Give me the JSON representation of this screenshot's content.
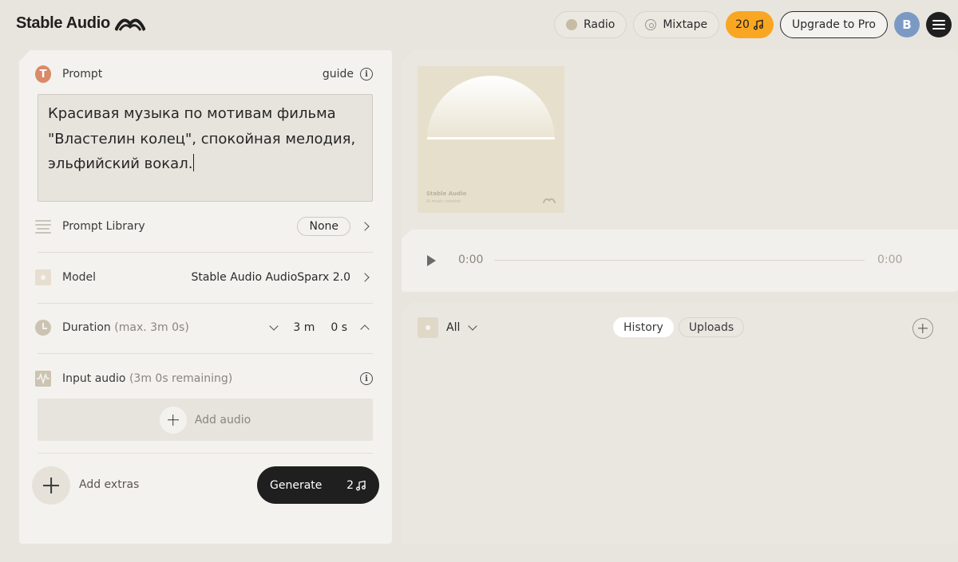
{
  "header": {
    "brand": "Stable Audio",
    "nav": {
      "radio_label": "Radio",
      "mixtape_label": "Mixtape",
      "credits": "20",
      "upgrade_label": "Upgrade to Pro",
      "avatar_initial": "B"
    }
  },
  "form": {
    "prompt": {
      "label": "Prompt",
      "icon_letter": "T",
      "guide_label": "guide",
      "value": "Красивая музыка по мотивам фильма \"Властелин колец\", спокойная мелодия, эльфийский вокал."
    },
    "prompt_library": {
      "label": "Prompt Library",
      "value": "None"
    },
    "model": {
      "label": "Model",
      "value": "Stable Audio AudioSparx 2.0"
    },
    "duration": {
      "label": "Duration",
      "hint": "(max. 3m 0s)",
      "minutes": "3 m",
      "seconds": "0 s"
    },
    "input_audio": {
      "label": "Input audio",
      "hint": "(3m 0s remaining)",
      "add_label": "Add audio"
    },
    "extras_label": "Add extras",
    "generate": {
      "label": "Generate",
      "cost": "2"
    }
  },
  "preview": {
    "cover_title": "Stable Audio",
    "cover_subtitle": "AI music creation",
    "time_current": "0:00",
    "time_total": "0:00"
  },
  "library": {
    "filter_label": "All",
    "tabs": [
      {
        "label": "History",
        "active": true
      },
      {
        "label": "Uploads",
        "active": false
      }
    ]
  },
  "colors": {
    "accent": "#f9a722",
    "background": "#e8e5df",
    "panel": "#f4f2ee",
    "generate": "#1f1f1f",
    "prompt_icon": "#d98a6a",
    "avatar": "#7b9ac3"
  }
}
